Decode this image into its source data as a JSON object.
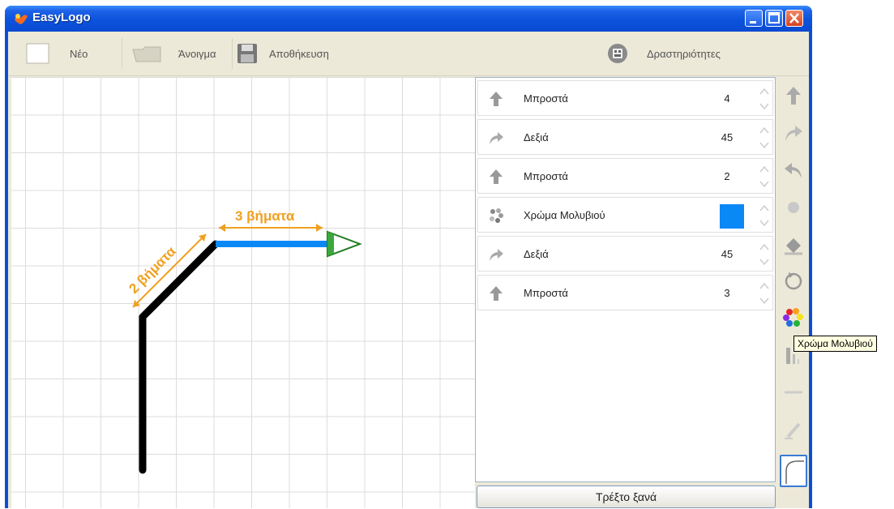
{
  "window": {
    "title": "EasyLogo"
  },
  "toolbar": {
    "new_label": "Νέο",
    "open_label": "Άνοιγμα",
    "save_label": "Αποθήκευση",
    "activities_label": "Δραστηριότητες"
  },
  "canvas": {
    "annotation_diagonal": "2 βήματα",
    "annotation_horizontal": "3 βήματα",
    "pen_colors": {
      "first": "#000000",
      "second": "#0a88f6",
      "annotation": "#f0a020"
    }
  },
  "commands": [
    {
      "icon": "up-arrow-icon",
      "label": "Μπροστά",
      "value": "4"
    },
    {
      "icon": "turn-right-icon",
      "label": "Δεξιά",
      "value": "45"
    },
    {
      "icon": "up-arrow-icon",
      "label": "Μπροστά",
      "value": "2"
    },
    {
      "icon": "color-palette-icon",
      "label": "Χρώμα Μολυβιού",
      "color": "#0a88f6"
    },
    {
      "icon": "turn-right-icon",
      "label": "Δεξιά",
      "value": "45"
    },
    {
      "icon": "up-arrow-icon",
      "label": "Μπροστά",
      "value": "3"
    }
  ],
  "run_button_label": "Τρέξτο ξανά",
  "palette": [
    "forward-icon",
    "turn-right-icon",
    "turn-left-icon",
    "pen-dot-icon",
    "fill-bucket-icon",
    "repeat-icon",
    "pen-color-icon",
    "pen-width-icon",
    "pen-up-icon",
    "pen-down-icon",
    "curve-icon"
  ],
  "tooltip": "Χρώμα Μολυβιού"
}
